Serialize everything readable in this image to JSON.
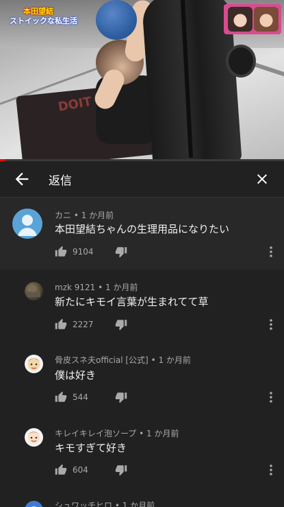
{
  "video": {
    "caption_line1": "本田望結",
    "caption_line2": "ストイックな私生活",
    "mat_text": "DOIT",
    "progress": 0.02
  },
  "header": {
    "back_icon": "arrow-left-icon",
    "title": "返信",
    "close_icon": "close-icon"
  },
  "colors": {
    "background": "#212121",
    "parent_comment_bg": "#282828",
    "meta_text": "#aaaaaa",
    "progress": "#ff0000"
  },
  "comments": [
    {
      "author": "カニ",
      "time": "1 か月前",
      "text": "本田望結ちゃんの生理用品になりたい",
      "likes": "9104",
      "avatar": "default-user-avatar"
    },
    {
      "author": "mzk 9121",
      "time": "1 か月前",
      "text": "新たにキモイ言葉が生まれてて草",
      "likes": "2227",
      "avatar": "photo-avatar"
    },
    {
      "author": "骨皮スネ夫official [公式]",
      "time": "1 か月前",
      "text": "僕は好き",
      "likes": "544",
      "avatar": "character-avatar"
    },
    {
      "author": "キレイキレイ泡ソープ",
      "time": "1 か月前",
      "text": "キモすぎて好き",
      "likes": "604",
      "avatar": "character-avatar"
    },
    {
      "author": "シュワッチヒロ",
      "time": "1 か月前",
      "avatar": "blue-avatar"
    }
  ],
  "separator": " • "
}
